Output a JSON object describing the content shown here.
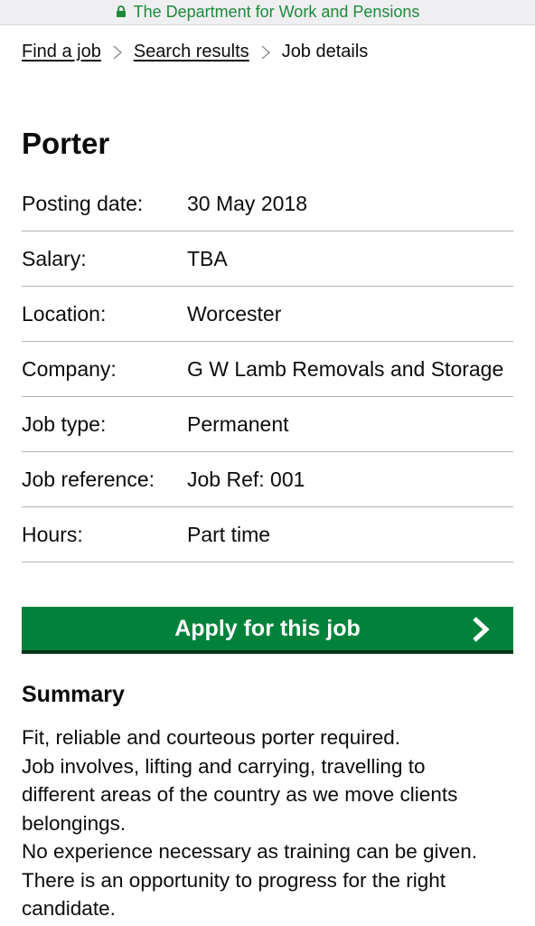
{
  "browser": {
    "url_text": "The Department for Work and Pensions",
    "lock_icon": "lock-icon"
  },
  "breadcrumb": {
    "items": [
      {
        "label": "Find a job",
        "link": true
      },
      {
        "label": "Search results",
        "link": true
      },
      {
        "label": "Job details",
        "link": false
      }
    ],
    "separator_icon": "chevron-right-icon"
  },
  "job": {
    "title": "Porter",
    "details": [
      {
        "key": "Posting date:",
        "value": "30 May 2018"
      },
      {
        "key": "Salary:",
        "value": "TBA"
      },
      {
        "key": "Location:",
        "value": "Worcester"
      },
      {
        "key": "Company:",
        "value": "G W Lamb Removals and Storage"
      },
      {
        "key": "Job type:",
        "value": "Permanent"
      },
      {
        "key": "Job reference:",
        "value": "Job Ref: 001"
      },
      {
        "key": "Hours:",
        "value": "Part time"
      }
    ]
  },
  "apply_button": {
    "label": "Apply for this job",
    "icon": "chevron-right-icon"
  },
  "summary": {
    "heading": "Summary",
    "lines": [
      "Fit, reliable and courteous porter required.",
      "Job involves, lifting and carrying, travelling to",
      "different areas of the country as we move clients",
      "belongings.",
      "No experience necessary as training can be given.",
      "There is an opportunity to progress for the right",
      "candidate."
    ]
  },
  "colors": {
    "url_green": "#1e8a3a",
    "button_green": "#00823b",
    "button_shadow": "#003618",
    "divider": "#b1b4b6"
  }
}
